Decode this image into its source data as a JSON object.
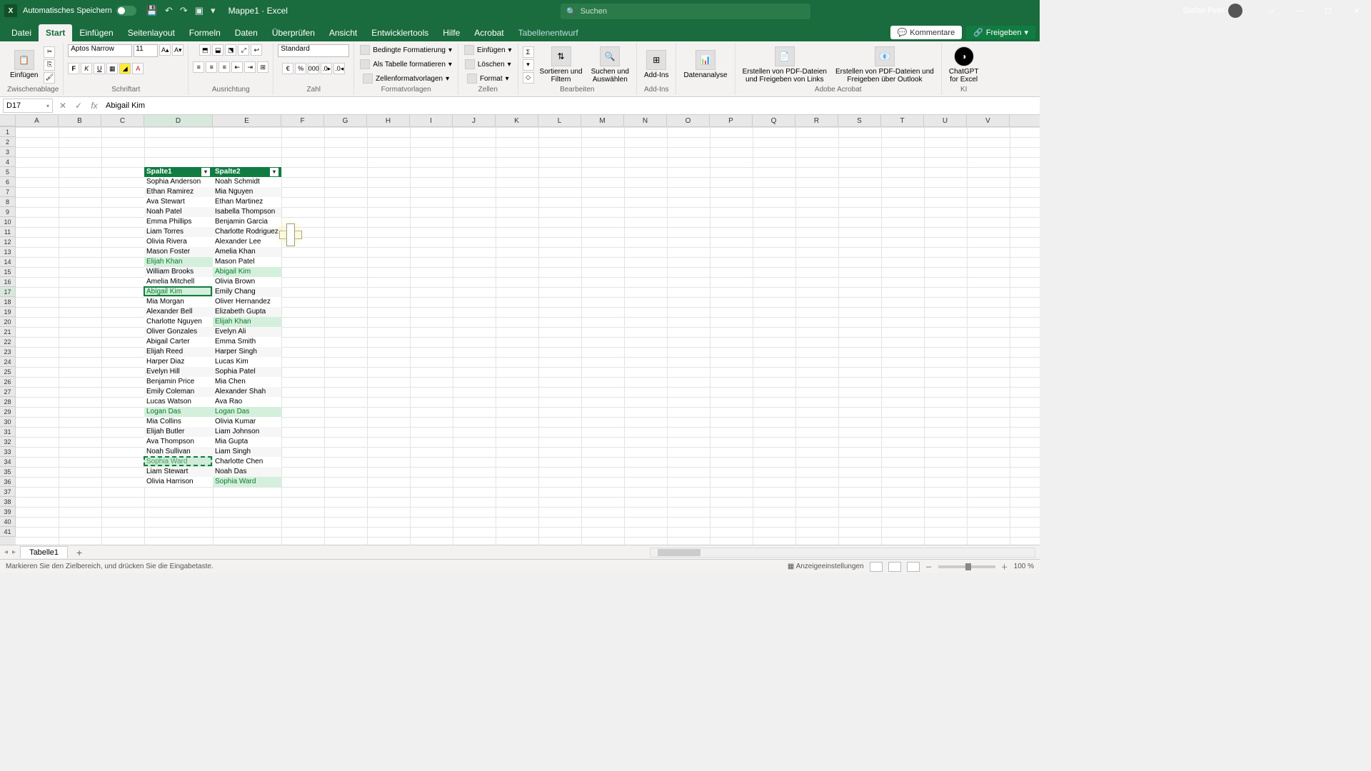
{
  "title_bar": {
    "autosave": "Automatisches Speichern",
    "doc": "Mappe1",
    "app": "Excel",
    "search_placeholder": "Suchen",
    "user": "Stefan Petri"
  },
  "tabs": {
    "datei": "Datei",
    "start": "Start",
    "einfuegen": "Einfügen",
    "seitenlayout": "Seitenlayout",
    "formeln": "Formeln",
    "daten": "Daten",
    "ueberpruefen": "Überprüfen",
    "ansicht": "Ansicht",
    "entwicklertools": "Entwicklertools",
    "hilfe": "Hilfe",
    "acrobat": "Acrobat",
    "tabellenentwurf": "Tabellenentwurf",
    "kommentare": "Kommentare",
    "freigeben": "Freigeben"
  },
  "ribbon": {
    "einfuegen": "Einfügen",
    "zwischenablage": "Zwischenablage",
    "font": "Aptos Narrow",
    "size": "11",
    "schriftart": "Schriftart",
    "ausrichtung": "Ausrichtung",
    "zahl": "Zahl",
    "number_format": "Standard",
    "fv": {
      "bedingte": "Bedingte Formatierung",
      "als_tabelle": "Als Tabelle formatieren",
      "zell": "Zellenformatvorlagen",
      "label": "Formatvorlagen"
    },
    "zellen": {
      "einfuegen": "Einfügen",
      "loeschen": "Löschen",
      "format": "Format",
      "label": "Zellen"
    },
    "bearb": {
      "sort": "Sortieren und\nFiltern",
      "suchen": "Suchen und\nAuswählen",
      "label": "Bearbeiten"
    },
    "addins": {
      "btn": "Add-Ins",
      "label": "Add-Ins"
    },
    "daten": "Datenanalyse",
    "adobe": {
      "b1": "Erstellen von PDF-Dateien\nund Freigeben von Links",
      "b2": "Erstellen von PDF-Dateien und\nFreigeben über Outlook",
      "label": "Adobe Acrobat"
    },
    "ki": {
      "gpt": "ChatGPT\nfor Excel",
      "label": "KI"
    }
  },
  "fbar": {
    "ref": "D17",
    "value": "Abigail Kim"
  },
  "columns": [
    "A",
    "B",
    "C",
    "D",
    "E",
    "F",
    "G",
    "H",
    "I",
    "J",
    "K",
    "L",
    "M",
    "N",
    "O",
    "P",
    "Q",
    "R",
    "S",
    "T",
    "U",
    "V"
  ],
  "chart_data": {
    "type": "table",
    "headers": [
      "Spalte1",
      "Spalte2"
    ],
    "rows": [
      [
        "Sophia Anderson",
        "Noah Schmidt"
      ],
      [
        "Ethan Ramirez",
        "Mia Nguyen"
      ],
      [
        "Ava Stewart",
        "Ethan Martinez"
      ],
      [
        "Noah Patel",
        "Isabella Thompson"
      ],
      [
        "Emma Phillips",
        "Benjamin Garcia"
      ],
      [
        "Liam Torres",
        "Charlotte Rodriguez"
      ],
      [
        "Olivia Rivera",
        "Alexander Lee"
      ],
      [
        "Mason Foster",
        "Amelia Khan"
      ],
      [
        "Elijah Khan",
        "Mason Patel"
      ],
      [
        "William Brooks",
        "Abigail Kim"
      ],
      [
        "Amelia Mitchell",
        "Olivia Brown"
      ],
      [
        "Abigail Kim",
        "Emily Chang"
      ],
      [
        "Mia Morgan",
        "Oliver Hernandez"
      ],
      [
        "Alexander Bell",
        "Elizabeth Gupta"
      ],
      [
        "Charlotte Nguyen",
        "Elijah Khan"
      ],
      [
        "Oliver Gonzales",
        "Evelyn Ali"
      ],
      [
        "Abigail Carter",
        "Emma Smith"
      ],
      [
        "Elijah Reed",
        "Harper Singh"
      ],
      [
        "Harper Diaz",
        "Lucas Kim"
      ],
      [
        "Evelyn Hill",
        "Sophia Patel"
      ],
      [
        "Benjamin Price",
        "Mia Chen"
      ],
      [
        "Emily Coleman",
        "Alexander Shah"
      ],
      [
        "Lucas Watson",
        "Ava Rao"
      ],
      [
        "Logan Das",
        "Logan Das"
      ],
      [
        "Mia Collins",
        "Olivia Kumar"
      ],
      [
        "Elijah Butler",
        "Liam Johnson"
      ],
      [
        "Ava Thompson",
        "Mia Gupta"
      ],
      [
        "Noah Sullivan",
        "Liam Singh"
      ],
      [
        "Sophia Ward",
        "Charlotte Chen"
      ],
      [
        "Liam Stewart",
        "Noah Das"
      ],
      [
        "Olivia Harrison",
        "Sophia Ward"
      ]
    ],
    "highlights_col1": {
      "8": true,
      "11": true,
      "23": true,
      "28": true
    },
    "highlights_col2": {
      "9": true,
      "14": true,
      "23": true,
      "30": true
    }
  },
  "sheet": {
    "tab1": "Tabelle1"
  },
  "status": {
    "msg": "Markieren Sie den Zielbereich, und drücken Sie die Eingabetaste.",
    "anzeige": "Anzeigeeinstellungen",
    "zoom": "100 %"
  }
}
